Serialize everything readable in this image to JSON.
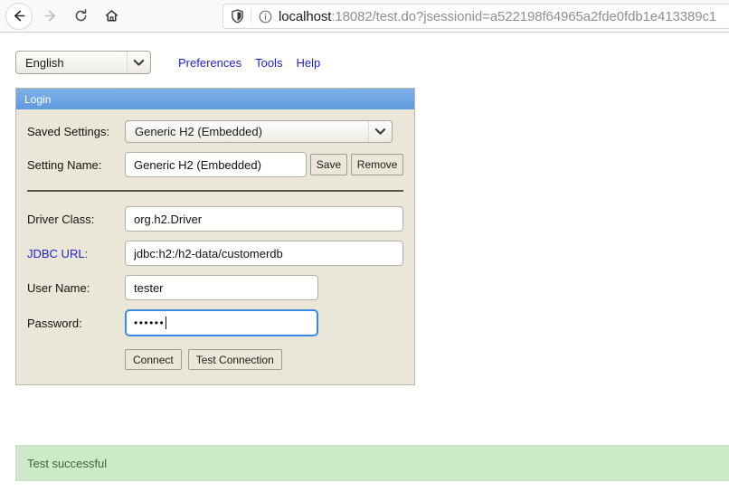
{
  "browser": {
    "back_icon": "arrow-left-icon",
    "forward_icon": "arrow-right-icon",
    "reload_icon": "reload-icon",
    "home_icon": "home-icon",
    "shield_icon": "shield-icon",
    "info_icon": "info-circle-icon",
    "url_host": "localhost",
    "url_rest": ":18082/test.do?jsessionid=a522198f64965a2fde0fdb1e413389c1"
  },
  "toolbar": {
    "language_value": "English",
    "chevron_icon": "chevron-down-icon",
    "links": [
      {
        "label": "Preferences"
      },
      {
        "label": "Tools"
      },
      {
        "label": "Help"
      }
    ]
  },
  "login": {
    "header_title": "Login",
    "saved_settings": {
      "label": "Saved Settings:",
      "value": "Generic H2 (Embedded)",
      "chevron_icon": "chevron-down-icon"
    },
    "setting_name": {
      "label": "Setting Name:",
      "value": "Generic H2 (Embedded)",
      "save_label": "Save",
      "remove_label": "Remove"
    },
    "driver_class": {
      "label": "Driver Class:",
      "value": "org.h2.Driver"
    },
    "jdbc_url": {
      "label": "JDBC URL:",
      "value": "jdbc:h2:/h2-data/customerdb"
    },
    "user_name": {
      "label": "User Name:",
      "value": "tester"
    },
    "password": {
      "label": "Password:",
      "value": "••••••"
    },
    "connect_label": "Connect",
    "test_connection_label": "Test Connection"
  },
  "status": {
    "message": "Test successful",
    "color": "#cdeac8",
    "text_color": "#33663a"
  },
  "colors": {
    "panel_bg": "#eae7d9",
    "header_blue": "#5e9ae0",
    "link_blue": "#2222cc",
    "focus_blue": "#3b8ce0"
  }
}
